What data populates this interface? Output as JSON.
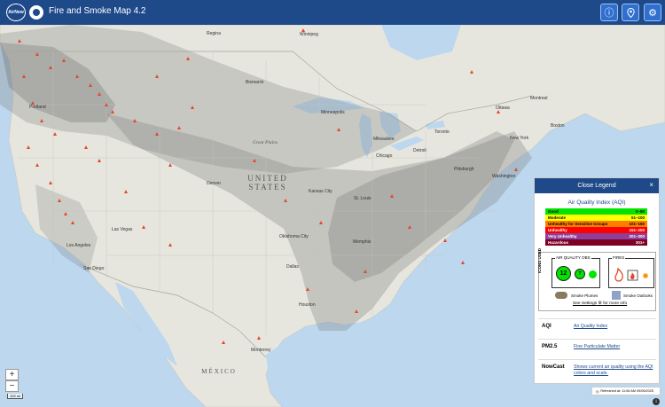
{
  "header": {
    "logo_text": "AirNow",
    "title": "Fire and Smoke Map 4.2",
    "icons": [
      "info-icon",
      "location-pin-icon",
      "gear-icon"
    ]
  },
  "map": {
    "country_labels": [
      "UNITED STATES",
      "MÉXICO"
    ],
    "region_labels": [
      "Great Plains"
    ],
    "cities": [
      "Regina",
      "Winnipeg",
      "Bismarck",
      "Minneapolis",
      "Ottawa",
      "Montreal",
      "Toronto",
      "Portland",
      "Milwaukee",
      "Chicago",
      "Boston",
      "Detroit",
      "New York",
      "Pittsburgh",
      "Denver",
      "Kansas City",
      "St. Louis",
      "Washington",
      "Las Vegas",
      "Los Angeles",
      "San Diego",
      "Oklahoma City",
      "Dallas",
      "Houston",
      "Memphis",
      "Monterrey"
    ],
    "zoom_in": "+",
    "zoom_out": "−",
    "scale": "100 mi"
  },
  "legend": {
    "header": "Close Legend",
    "close_symbol": "×",
    "aqi_title": "Air Quality Index (AQI)",
    "aqi_levels": [
      {
        "label": "Good",
        "range": "0–50",
        "color": "#00e400",
        "text_color": "#000000"
      },
      {
        "label": "Moderate",
        "range": "51–100",
        "color": "#ffff00",
        "text_color": "#000000"
      },
      {
        "label": "Unhealthy for Sensitive Groups",
        "range": "101–150",
        "color": "#ff7e00",
        "text_color": "#000000"
      },
      {
        "label": "Unhealthy",
        "range": "151–200",
        "color": "#ff0000",
        "text_color": "#ffffff"
      },
      {
        "label": "Very Unhealthy",
        "range": "201–300",
        "color": "#8f3f97",
        "text_color": "#ffffff"
      },
      {
        "label": "Hazardous",
        "range": "301+",
        "color": "#7e0023",
        "text_color": "#ffffff"
      }
    ],
    "icons_used": "ICONS USED",
    "aq_obs": "AIR QUALITY OBS",
    "aq_obs_value": "12",
    "aq_obs_t": "T",
    "fires": "FIRES",
    "smoke_plumes": "Smoke Plumes",
    "smoke_outlooks": "Smoke Outlooks",
    "settings_prefix": "See Settings",
    "settings_suffix": "for more info",
    "terms": [
      {
        "term": "AQI",
        "definition": "Air Quality Index"
      },
      {
        "term": "PM2.5",
        "definition": "Fine Particulate Matter"
      },
      {
        "term": "NowCast",
        "definition": "Shows current air quality using the AQI colors and scale."
      }
    ]
  },
  "refresh": {
    "text": "Refreshed at: 11:06 AM 09/05/2025"
  }
}
